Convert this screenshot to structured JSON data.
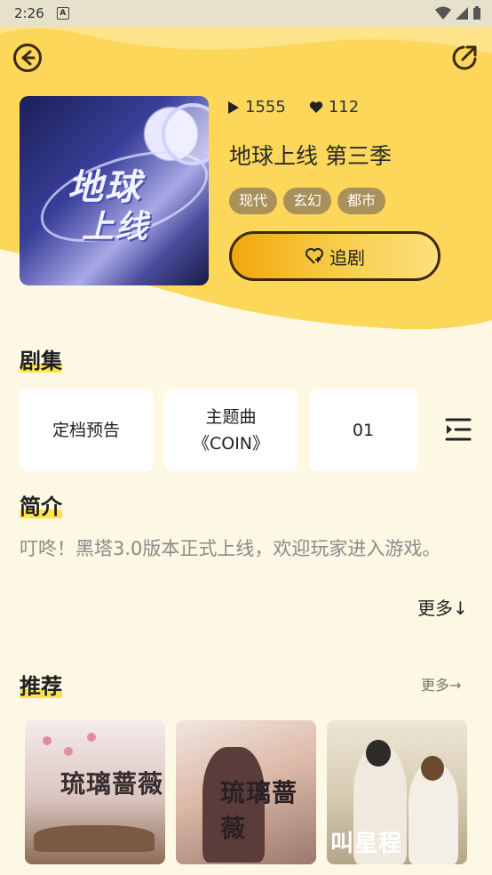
{
  "status_bar": {
    "time": "2:26",
    "icon": "A"
  },
  "header": {
    "back_icon": "arrow-left-circle-icon",
    "share_icon": "share-external-icon"
  },
  "drama": {
    "play_count": "1555",
    "like_count": "112",
    "title": "地球上线 第三季",
    "tags": [
      "现代",
      "玄幻",
      "都市"
    ],
    "follow_label": "追剧",
    "cover_text": [
      "地球",
      "上线"
    ]
  },
  "episodes": {
    "section_title": "剧集",
    "items": [
      "定档预告",
      "主题曲\n《COIN》",
      "01"
    ]
  },
  "intro": {
    "section_title": "简介",
    "text": "叮咚！黑塔3.0版本正式上线，欢迎玩家进入游戏。",
    "more_label": "更多↓"
  },
  "recommend": {
    "section_title": "推荐",
    "more_label": "更多→",
    "items": [
      {
        "cover_text": "琉璃蔷薇"
      },
      {
        "cover_text": "琉璃蔷薇"
      },
      {
        "cover_text": "叫星程"
      }
    ]
  },
  "colors": {
    "accent": "#fcd34d",
    "tag": "#a8915a",
    "background": "#fdf8e3"
  }
}
